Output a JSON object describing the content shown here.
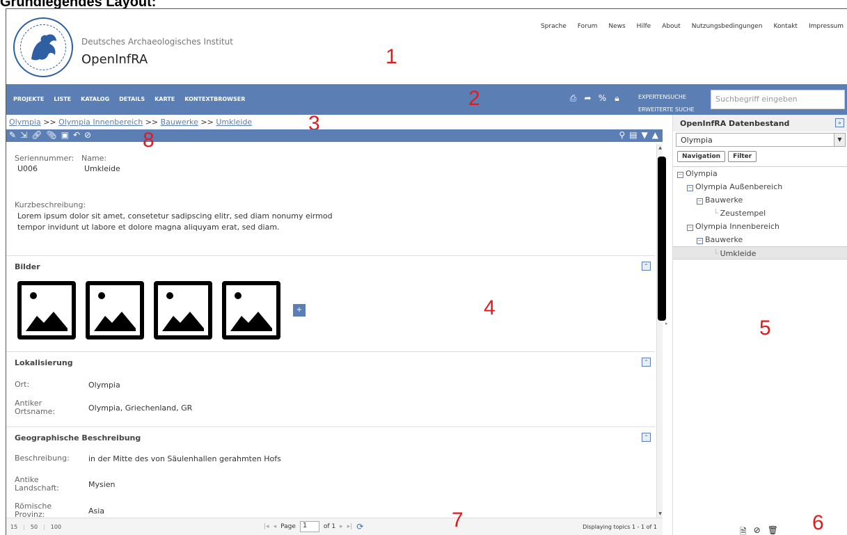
{
  "page_heading": "Grundlegendes Layout:",
  "header": {
    "org": "Deutsches Archaeologisches Institut",
    "app_title": "OpenInfRA",
    "top_links": [
      "Sprache",
      "Forum",
      "News",
      "Hilfe",
      "About",
      "Nutzungsbedingungen",
      "Kontakt",
      "Impressum"
    ]
  },
  "annotations": {
    "a1": "1",
    "a2": "2",
    "a3": "3",
    "a4": "4",
    "a5": "5",
    "a6": "6",
    "a7": "7",
    "a8": "8"
  },
  "nav": {
    "items": [
      "PROJEKTE",
      "LISTE",
      "KATALOG",
      "DETAILS",
      "KARTE",
      "KONTEXTBROWSER"
    ],
    "expert_search": "EXPERTENSUCHE",
    "advanced_search": "ERWEITERTE SUCHE",
    "search_placeholder": "Suchbegriff eingeben",
    "tool_icons": [
      "print-icon",
      "export-icon",
      "share-icon",
      "lock-icon"
    ]
  },
  "breadcrumb": {
    "items": [
      "Olympia",
      "Olympia Innenbereich",
      "Bauwerke",
      "Umkleide"
    ],
    "separator": ">>"
  },
  "detail": {
    "serial_label": "Seriennummer:",
    "serial_value": "U006",
    "name_label": "Name:",
    "name_value": "Umkleide",
    "short_desc_label": "Kurzbeschreibung:",
    "short_desc_line1": "Lorem ipsum dolor sit amet, consetetur sadipscing elitr, sed diam nonumy eirmod",
    "short_desc_line2": "tempor invidunt ut labore et dolore magna aliquyam erat, sed diam."
  },
  "sections": {
    "images": {
      "title": "Bilder",
      "add_label": "+"
    },
    "localization": {
      "title": "Lokalisierung",
      "fields": [
        {
          "label": "Ort:",
          "value": "Olympia"
        },
        {
          "label": "Antiker Ortsname:",
          "value": "Olympia, Griechenland, GR"
        }
      ]
    },
    "geo": {
      "title": "Geographische Beschreibung",
      "fields": [
        {
          "label": "Beschreibung:",
          "value": "in der Mitte des von Säulenhallen gerahmten Hofs"
        },
        {
          "label": "Antike Landschaft:",
          "value": "Mysien"
        },
        {
          "label": "Römische Provinz:",
          "value": "Asia"
        }
      ]
    }
  },
  "pager": {
    "page_sizes": [
      "15",
      "50",
      "100"
    ],
    "page_label": "Page",
    "page_value": "1",
    "of_label": "of 1",
    "display_info": "Displaying topics 1 - 1 of 1"
  },
  "side": {
    "title": "OpenInfRA Datenbestand",
    "selected_project": "Olympia",
    "tabs": [
      "Navigation",
      "Filter"
    ],
    "tree": [
      {
        "label": "Olympia",
        "level": 0,
        "expandable": true
      },
      {
        "label": "Olympia Außenbereich",
        "level": 1,
        "expandable": true
      },
      {
        "label": "Bauwerke",
        "level": 2,
        "expandable": true
      },
      {
        "label": "Zeustempel",
        "level": 3,
        "expandable": false
      },
      {
        "label": "Olympia Innenbereich",
        "level": 1,
        "expandable": true
      },
      {
        "label": "Bauwerke",
        "level": 2,
        "expandable": true
      },
      {
        "label": "Umkleide",
        "level": 3,
        "expandable": false,
        "selected": true
      }
    ]
  },
  "colors": {
    "accent": "#5b7eb5",
    "annotation": "#e41a1c"
  }
}
